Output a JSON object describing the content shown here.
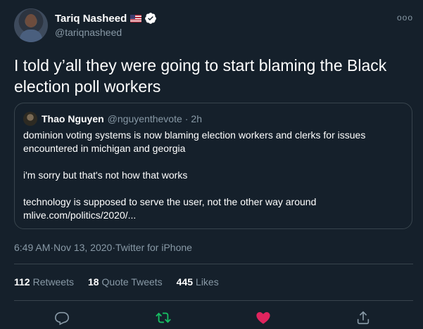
{
  "author": {
    "display_name": "Tariq Nasheed",
    "handle": "@tariqnasheed",
    "flag_icon": "us-flag-icon",
    "verified_icon": "verified-badge-icon"
  },
  "more_icon": "more-icon",
  "tweet": {
    "text": "I told y’all they were going to start blaming the Black election poll workers"
  },
  "quote": {
    "display_name": "Thao Nguyen",
    "handle": "@nguyenthevote",
    "separator": "·",
    "time": "2h",
    "lines": [
      "dominion voting systems is now blaming election workers and clerks for issues encountered in michigan and georgia",
      "i'm sorry but that's not how that works",
      "technology is supposed to serve the user, not the other way around",
      "mlive.com/politics/2020/..."
    ]
  },
  "meta": {
    "time": "6:49 AM",
    "date": "Nov 13, 2020",
    "source": "Twitter for iPhone",
    "sep": " · "
  },
  "stats": {
    "retweets_count": "112",
    "retweets_label": "Retweets",
    "quotes_count": "18",
    "quotes_label": "Quote Tweets",
    "likes_count": "445",
    "likes_label": "Likes"
  },
  "actions": {
    "reply_icon": "reply-icon",
    "retweet_icon": "retweet-icon",
    "like_icon": "heart-icon",
    "share_icon": "share-icon"
  },
  "colors": {
    "background": "#15202b",
    "secondary_text": "#8899a6",
    "border": "#38444d",
    "retweet_active": "#17bf63",
    "like_active": "#e0245e",
    "verified": "#ffffff"
  }
}
